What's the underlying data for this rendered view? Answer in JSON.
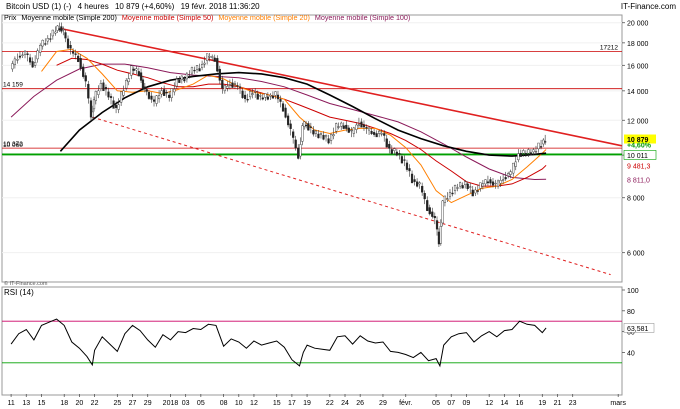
{
  "header": {
    "title": "Bitcoin USD (1) (-)",
    "timeframe": "4 heures",
    "quote": "10 879 (+4,60%)",
    "datetime": "19 févr. 2018 11:36:20",
    "brand": "IT-Finance.com",
    "legend_price": "Prix",
    "legend_sma200": "Moyenne mobile (Simple 200)",
    "legend_sma50": "Moyenne mobile (Simple 50)",
    "legend_sma20": "Moyenne mobile (Simple 20)",
    "legend_sma100": "Moyenne mobile (Simple 100)",
    "watermark": "© IT-Finance.com"
  },
  "rsi_panel": {
    "label": "RSI (14)"
  },
  "colors": {
    "sma200": "#000000",
    "sma50": "#cc0000",
    "sma20": "#ff7f00",
    "sma100": "#8b1a5a",
    "resistance": "#e02020",
    "horizontal": "#cc0000",
    "support": "#00a000",
    "last_price_bg": "#ffff00"
  },
  "chart_data": [
    {
      "type": "candlestick",
      "title": "Bitcoin USD (1) (-)",
      "ylim": [
        5200,
        20500
      ],
      "y_scale": "log",
      "y_ticks": [
        6000,
        8000,
        10000,
        12000,
        14000,
        16000,
        18000,
        20000
      ],
      "y_tick_labels": [
        "6 000",
        "8 000",
        "10 000",
        "12 000",
        "14 000",
        "16 000",
        "18 000",
        "20 000"
      ],
      "x_tick_labels": [
        "11",
        "13",
        "15",
        "18",
        "20",
        "22",
        "25",
        "27",
        "29",
        "2018",
        "03",
        "05",
        "08",
        "10",
        "12",
        "15",
        "17",
        "19",
        "22",
        "24",
        "26",
        "29",
        "févr.",
        "05",
        "07",
        "09",
        "12",
        "14",
        "16",
        "19",
        "21",
        "23",
        "mars"
      ],
      "x_tick_days": [
        0,
        2,
        4,
        7,
        9,
        11,
        14,
        16,
        18,
        21,
        23,
        25,
        28,
        30,
        32,
        35,
        37,
        39,
        42,
        44,
        46,
        49,
        52,
        56,
        58,
        60,
        63,
        65,
        67,
        70,
        72,
        74,
        80
      ],
      "x_start": "2017-12-11",
      "x_range_days": [
        -1.2,
        80.5
      ],
      "price_path": [
        [
          0,
          15700
        ],
        [
          1,
          16800
        ],
        [
          2,
          17000
        ],
        [
          3,
          16000
        ],
        [
          4,
          17700
        ],
        [
          5,
          18400
        ],
        [
          6,
          19200
        ],
        [
          6.5,
          19600
        ],
        [
          7,
          19000
        ],
        [
          8,
          17200
        ],
        [
          9,
          16600
        ],
        [
          10,
          14500
        ],
        [
          10.7,
          12200
        ],
        [
          11,
          13300
        ],
        [
          12,
          14600
        ],
        [
          13,
          13600
        ],
        [
          14,
          12700
        ],
        [
          15,
          14200
        ],
        [
          16,
          15700
        ],
        [
          17,
          15400
        ],
        [
          17.5,
          14300
        ],
        [
          18,
          13900
        ],
        [
          19,
          13100
        ],
        [
          20,
          14100
        ],
        [
          21,
          13500
        ],
        [
          22,
          14800
        ],
        [
          23,
          14900
        ],
        [
          24,
          15600
        ],
        [
          25,
          15800
        ],
        [
          26,
          16700
        ],
        [
          27,
          16600
        ],
        [
          28,
          14000
        ],
        [
          29,
          14600
        ],
        [
          30,
          14300
        ],
        [
          31,
          13400
        ],
        [
          32,
          13900
        ],
        [
          33,
          13500
        ],
        [
          34,
          13600
        ],
        [
          35,
          13700
        ],
        [
          36,
          12800
        ],
        [
          37,
          11300
        ],
        [
          38,
          9950
        ],
        [
          38.5,
          11600
        ],
        [
          39,
          11800
        ],
        [
          40,
          11200
        ],
        [
          41,
          11100
        ],
        [
          42,
          10800
        ],
        [
          43,
          11600
        ],
        [
          44,
          11700
        ],
        [
          45,
          11200
        ],
        [
          46,
          11900
        ],
        [
          47,
          11400
        ],
        [
          48,
          11200
        ],
        [
          49,
          11200
        ],
        [
          50,
          10300
        ],
        [
          51,
          10100
        ],
        [
          52,
          9600
        ],
        [
          53,
          8800
        ],
        [
          54,
          8500
        ],
        [
          55,
          7600
        ],
        [
          56,
          7100
        ],
        [
          56.5,
          6300
        ],
        [
          57,
          7800
        ],
        [
          58,
          8200
        ],
        [
          59,
          8500
        ],
        [
          60,
          8600
        ],
        [
          61,
          8200
        ],
        [
          62,
          8500
        ],
        [
          63,
          8800
        ],
        [
          64,
          8500
        ],
        [
          65,
          8900
        ],
        [
          66,
          9100
        ],
        [
          67,
          10100
        ],
        [
          68,
          10100
        ],
        [
          69,
          10200
        ],
        [
          70,
          10600
        ],
        [
          70.5,
          10879
        ]
      ],
      "sma20": [
        [
          4,
          15500
        ],
        [
          6,
          17200
        ],
        [
          8,
          17400
        ],
        [
          10,
          16600
        ],
        [
          12,
          15300
        ],
        [
          14,
          14000
        ],
        [
          16,
          13900
        ],
        [
          18,
          14000
        ],
        [
          20,
          13800
        ],
        [
          22,
          14100
        ],
        [
          24,
          14500
        ],
        [
          26,
          15200
        ],
        [
          28,
          14900
        ],
        [
          30,
          14300
        ],
        [
          32,
          13900
        ],
        [
          34,
          13700
        ],
        [
          36,
          13400
        ],
        [
          38,
          12200
        ],
        [
          40,
          11400
        ],
        [
          42,
          11200
        ],
        [
          44,
          11400
        ],
        [
          46,
          11500
        ],
        [
          48,
          11500
        ],
        [
          50,
          11100
        ],
        [
          52,
          10400
        ],
        [
          54,
          9500
        ],
        [
          56,
          8300
        ],
        [
          58,
          7800
        ],
        [
          60,
          8100
        ],
        [
          62,
          8400
        ],
        [
          64,
          8500
        ],
        [
          66,
          8800
        ],
        [
          68,
          9400
        ],
        [
          70,
          10100
        ],
        [
          70.5,
          10300
        ]
      ],
      "sma50": [
        [
          6,
          16000
        ],
        [
          8,
          16600
        ],
        [
          10,
          16500
        ],
        [
          12,
          16100
        ],
        [
          14,
          15600
        ],
        [
          16,
          15300
        ],
        [
          18,
          15000
        ],
        [
          20,
          14600
        ],
        [
          22,
          14300
        ],
        [
          24,
          14300
        ],
        [
          26,
          14500
        ],
        [
          28,
          14500
        ],
        [
          30,
          14300
        ],
        [
          32,
          14000
        ],
        [
          34,
          13700
        ],
        [
          36,
          13400
        ],
        [
          38,
          13000
        ],
        [
          40,
          12600
        ],
        [
          42,
          12200
        ],
        [
          44,
          12000
        ],
        [
          46,
          11800
        ],
        [
          48,
          11500
        ],
        [
          50,
          11200
        ],
        [
          52,
          10800
        ],
        [
          54,
          10300
        ],
        [
          56,
          9700
        ],
        [
          58,
          9200
        ],
        [
          60,
          8700
        ],
        [
          62,
          8500
        ],
        [
          64,
          8500
        ],
        [
          66,
          8600
        ],
        [
          68,
          8900
        ],
        [
          70,
          9300
        ],
        [
          70.5,
          9481.3
        ]
      ],
      "sma100": [
        [
          0,
          12200
        ],
        [
          3,
          13600
        ],
        [
          6,
          14800
        ],
        [
          9,
          15700
        ],
        [
          12,
          16100
        ],
        [
          15,
          16100
        ],
        [
          18,
          15800
        ],
        [
          21,
          15400
        ],
        [
          24,
          15200
        ],
        [
          27,
          15100
        ],
        [
          30,
          15000
        ],
        [
          33,
          14700
        ],
        [
          36,
          14300
        ],
        [
          39,
          13700
        ],
        [
          42,
          13100
        ],
        [
          45,
          12700
        ],
        [
          48,
          12300
        ],
        [
          51,
          11900
        ],
        [
          54,
          11300
        ],
        [
          57,
          10600
        ],
        [
          60,
          9900
        ],
        [
          63,
          9300
        ],
        [
          66,
          8900
        ],
        [
          69,
          8800
        ],
        [
          70.5,
          8811
        ]
      ],
      "sma200": [
        [
          6.5,
          10200
        ],
        [
          9,
          11400
        ],
        [
          12,
          12500
        ],
        [
          15,
          13500
        ],
        [
          18,
          14300
        ],
        [
          21,
          14800
        ],
        [
          24,
          15100
        ],
        [
          27,
          15300
        ],
        [
          30,
          15400
        ],
        [
          33,
          15300
        ],
        [
          36,
          15000
        ],
        [
          39,
          14500
        ],
        [
          42,
          13700
        ],
        [
          45,
          12900
        ],
        [
          48,
          12100
        ],
        [
          51,
          11400
        ],
        [
          54,
          10900
        ],
        [
          57,
          10500
        ],
        [
          60,
          10200
        ],
        [
          63,
          10000
        ],
        [
          66,
          9950
        ],
        [
          68,
          10000
        ],
        [
          70.5,
          10100
        ]
      ],
      "resistance_line": [
        [
          6.5,
          19400
        ],
        [
          80.5,
          10500
        ]
      ],
      "support_line": [
        [
          10.7,
          12200
        ],
        [
          79,
          5350
        ]
      ],
      "horizontal_lines": [
        {
          "label": "17212",
          "value": 17212
        },
        {
          "label": "14 159",
          "value": 14159
        },
        {
          "label": "10 372",
          "value": 10372
        }
      ],
      "support_levels": [
        {
          "label": "10 011",
          "value": 10011
        },
        {
          "label": "10 060",
          "value": 10060
        }
      ],
      "right_labels": [
        {
          "text": "10 879",
          "value": 10879,
          "style": "last"
        },
        {
          "text": "+4,60%",
          "value": 10560,
          "style": "change"
        },
        {
          "text": "10 011",
          "value": 10011,
          "style": "support"
        },
        {
          "text": "9 481,3",
          "value": 9481.3,
          "style": "sma50"
        },
        {
          "text": "8 811,0",
          "value": 8811,
          "style": "sma100"
        }
      ]
    },
    {
      "type": "line",
      "title": "RSI (14)",
      "ylim": [
        0,
        100
      ],
      "y_ticks": [
        40,
        60,
        80,
        100
      ],
      "levels": [
        70,
        30
      ],
      "last_value": "63,581",
      "rsi": [
        [
          0,
          48
        ],
        [
          1,
          58
        ],
        [
          2,
          62
        ],
        [
          3,
          52
        ],
        [
          4,
          66
        ],
        [
          5,
          69
        ],
        [
          6,
          72
        ],
        [
          7,
          66
        ],
        [
          8,
          50
        ],
        [
          9,
          44
        ],
        [
          10,
          36
        ],
        [
          10.7,
          28
        ],
        [
          11,
          42
        ],
        [
          12,
          55
        ],
        [
          13,
          48
        ],
        [
          14,
          41
        ],
        [
          15,
          58
        ],
        [
          16,
          66
        ],
        [
          17,
          61
        ],
        [
          18,
          52
        ],
        [
          19,
          45
        ],
        [
          20,
          57
        ],
        [
          21,
          52
        ],
        [
          22,
          60
        ],
        [
          23,
          59
        ],
        [
          24,
          63
        ],
        [
          25,
          62
        ],
        [
          26,
          67
        ],
        [
          27,
          66
        ],
        [
          28,
          46
        ],
        [
          29,
          53
        ],
        [
          30,
          50
        ],
        [
          31,
          44
        ],
        [
          32,
          51
        ],
        [
          33,
          47
        ],
        [
          34,
          49
        ],
        [
          35,
          51
        ],
        [
          36,
          45
        ],
        [
          37,
          33
        ],
        [
          38,
          27
        ],
        [
          38.5,
          40
        ],
        [
          39,
          47
        ],
        [
          40,
          44
        ],
        [
          41,
          43
        ],
        [
          42,
          42
        ],
        [
          43,
          55
        ],
        [
          44,
          56
        ],
        [
          45,
          48
        ],
        [
          46,
          56
        ],
        [
          47,
          51
        ],
        [
          48,
          49
        ],
        [
          49,
          50
        ],
        [
          50,
          41
        ],
        [
          51,
          40
        ],
        [
          52,
          38
        ],
        [
          53,
          35
        ],
        [
          54,
          40
        ],
        [
          55,
          32
        ],
        [
          56,
          34
        ],
        [
          56.5,
          27
        ],
        [
          57,
          47
        ],
        [
          58,
          55
        ],
        [
          59,
          58
        ],
        [
          60,
          59
        ],
        [
          61,
          50
        ],
        [
          62,
          56
        ],
        [
          63,
          60
        ],
        [
          64,
          55
        ],
        [
          65,
          61
        ],
        [
          66,
          62
        ],
        [
          67,
          70
        ],
        [
          68,
          67
        ],
        [
          69,
          66
        ],
        [
          70,
          59
        ],
        [
          70.5,
          63.581
        ]
      ]
    }
  ]
}
